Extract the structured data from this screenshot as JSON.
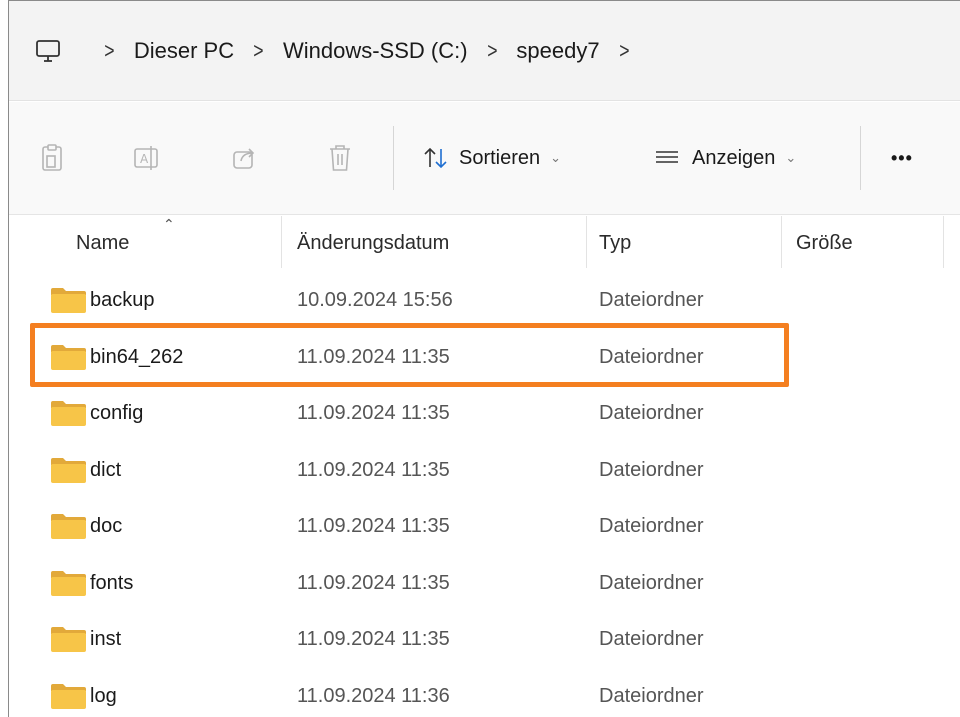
{
  "breadcrumb": {
    "root_icon": "monitor-icon",
    "separator": ">",
    "items": [
      {
        "label": "Dieser PC"
      },
      {
        "label": "Windows-SSD (C:)"
      },
      {
        "label": "speedy7"
      }
    ]
  },
  "toolbar": {
    "icons": [
      "copy-icon",
      "rename-icon",
      "share-icon",
      "delete-icon"
    ],
    "sort_label": "Sortieren",
    "view_label": "Anzeigen",
    "more_label": "•••"
  },
  "columns": {
    "name": "Name",
    "date": "Änderungsdatum",
    "type": "Typ",
    "size": "Größe"
  },
  "files": [
    {
      "name": "backup",
      "date": "10.09.2024 15:56",
      "type": "Dateiordner"
    },
    {
      "name": "bin64_262",
      "date": "11.09.2024 11:35",
      "type": "Dateiordner",
      "highlighted": true
    },
    {
      "name": "config",
      "date": "11.09.2024 11:35",
      "type": "Dateiordner"
    },
    {
      "name": "dict",
      "date": "11.09.2024 11:35",
      "type": "Dateiordner"
    },
    {
      "name": "doc",
      "date": "11.09.2024 11:35",
      "type": "Dateiordner"
    },
    {
      "name": "fonts",
      "date": "11.09.2024 11:35",
      "type": "Dateiordner"
    },
    {
      "name": "inst",
      "date": "11.09.2024 11:35",
      "type": "Dateiordner"
    },
    {
      "name": "log",
      "date": "11.09.2024 11:36",
      "type": "Dateiordner"
    }
  ],
  "colors": {
    "highlight": "#f47f20",
    "folder": "#f7c548"
  }
}
